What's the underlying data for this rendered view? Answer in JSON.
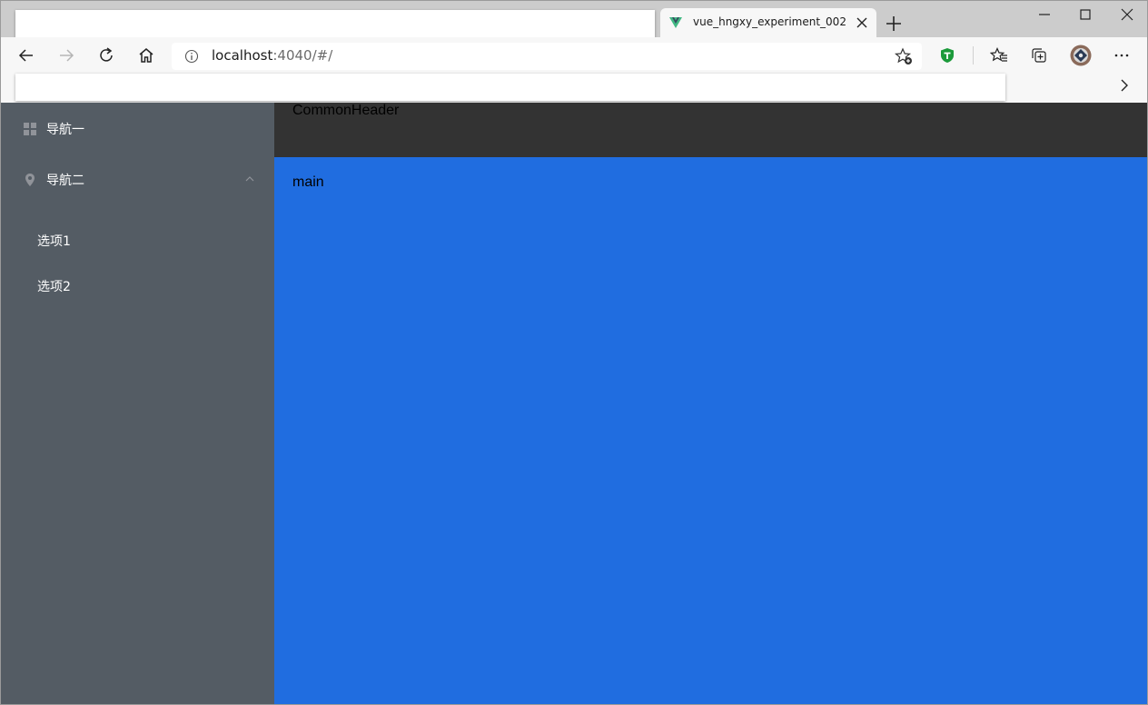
{
  "browser": {
    "tab": {
      "title": "vue_hngxy_experiment_002",
      "favicon": "vue-logo-icon"
    },
    "address": {
      "host": "localhost",
      "rest": ":4040/#/"
    },
    "toolbar_icons": [
      "back-icon",
      "forward-icon",
      "refresh-icon",
      "home-icon",
      "info-icon",
      "add-favorite-icon",
      "shield-extension-icon",
      "favorites-icon",
      "collections-icon",
      "profile-avatar",
      "more-icon"
    ],
    "colors": {
      "tab_strip": "#cccccc",
      "toolbar": "#f7f7f7"
    }
  },
  "app": {
    "sidebar": {
      "bg": "#545c64",
      "items": [
        {
          "label": "导航一",
          "icon": "grid-menu-icon"
        },
        {
          "label": "导航二",
          "icon": "location-icon",
          "expanded": true,
          "children": [
            {
              "label": "选项1"
            },
            {
              "label": "选项2"
            }
          ]
        }
      ]
    },
    "header": {
      "text": "CommonHeader",
      "bg": "#333333"
    },
    "main": {
      "text": "main",
      "bg": "#206de0"
    }
  }
}
